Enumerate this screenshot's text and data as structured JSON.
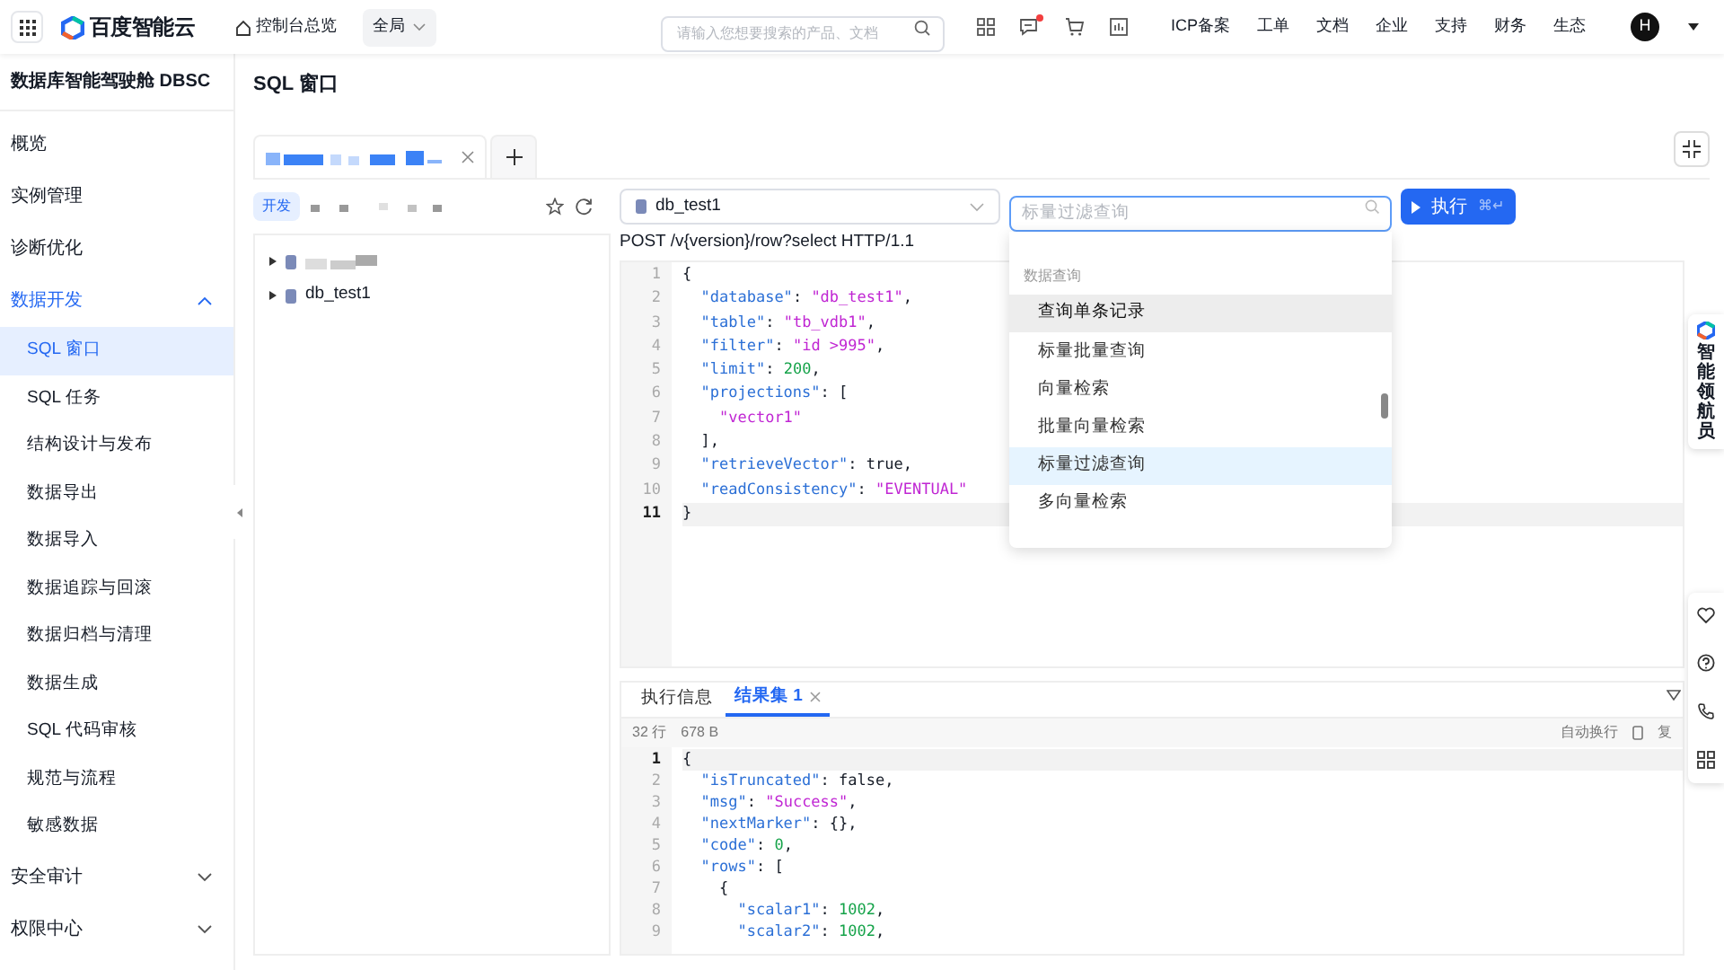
{
  "topbar": {
    "logo": "百度智能云",
    "console": "控制台总览",
    "scope": "全局",
    "search": {
      "placeholder": "请输入您想要搜索的产品、文档"
    },
    "links": [
      "ICP备案",
      "工单",
      "文档",
      "企业",
      "支持",
      "财务",
      "生态"
    ],
    "avatar": "H",
    "has_message_dot": true
  },
  "sidebar": {
    "title": "数据库智能驾驶舱 DBSC",
    "items": [
      {
        "label": "概览",
        "selected": false
      },
      {
        "label": "实例管理",
        "selected": false
      },
      {
        "label": "诊断优化",
        "selected": false
      },
      {
        "label": "数据开发",
        "expanded": true,
        "children": [
          {
            "label": "SQL 窗口",
            "selected": true
          },
          {
            "label": "SQL 任务",
            "selected": false
          },
          {
            "label": "结构设计与发布",
            "selected": false
          },
          {
            "label": "数据导出",
            "selected": false
          },
          {
            "label": "数据导入",
            "selected": false
          },
          {
            "label": "数据追踪与回滚",
            "selected": false
          },
          {
            "label": "数据归档与清理",
            "selected": false
          },
          {
            "label": "数据生成",
            "selected": false
          },
          {
            "label": "SQL 代码审核",
            "selected": false
          },
          {
            "label": "规范与流程",
            "selected": false
          },
          {
            "label": "敏感数据",
            "selected": false
          }
        ]
      },
      {
        "label": "安全审计",
        "expanded": false
      },
      {
        "label": "权限中心",
        "expanded": false
      }
    ]
  },
  "page_title": "SQL 窗口",
  "env_tag": "开发",
  "tree": [
    {
      "redacted": true
    },
    {
      "label": "db_test1",
      "redacted": false
    }
  ],
  "database_select": "db_test1",
  "api_search": {
    "placeholder": "标量过滤查询"
  },
  "run_button": {
    "label": "执行",
    "shortcut": "⌘↵"
  },
  "request_line": "POST /v{version}/row?select HTTP/1.1",
  "editor_lines": [
    {
      "number": "1",
      "code": "{",
      "current": false
    },
    {
      "number": "2",
      "code": "  \"database\": \"db_test1\",",
      "current": false
    },
    {
      "number": "3",
      "code": "  \"table\": \"tb_vdb1\",",
      "current": false
    },
    {
      "number": "4",
      "code": "  \"filter\": \"id >995\",",
      "current": false
    },
    {
      "number": "5",
      "code": "  \"limit\": 200,",
      "current": false
    },
    {
      "number": "6",
      "code": "  \"projections\": [",
      "current": false
    },
    {
      "number": "7",
      "code": "    \"vector1\"",
      "current": false
    },
    {
      "number": "8",
      "code": "  ],",
      "current": false
    },
    {
      "number": "9",
      "code": "  \"retrieveVector\": true,",
      "current": false
    },
    {
      "number": "10",
      "code": "  \"readConsistency\": \"EVENTUAL\"",
      "current": false
    },
    {
      "number": "11",
      "code": "}",
      "current": true
    }
  ],
  "dropdown": {
    "group": "数据查询",
    "options": [
      {
        "label": "查询单条记录",
        "hovered": true,
        "selected": false
      },
      {
        "label": "标量批量查询",
        "hovered": false,
        "selected": false
      },
      {
        "label": "向量检索",
        "hovered": false,
        "selected": false
      },
      {
        "label": "批量向量检索",
        "hovered": false,
        "selected": false
      },
      {
        "label": "标量过滤查询",
        "hovered": false,
        "selected": true
      },
      {
        "label": "多向量检索",
        "hovered": false,
        "selected": false
      }
    ]
  },
  "result_tabs": [
    {
      "label": "执行信息",
      "selected": false,
      "closable": false
    },
    {
      "label": "结果集 1",
      "selected": true,
      "closable": true
    }
  ],
  "result_stats": [
    "32 行",
    "678 B"
  ],
  "result_actions": {
    "wrap": "自动换行",
    "copy": "复"
  },
  "result_lines": [
    {
      "number": "1",
      "code": "{",
      "current": true
    },
    {
      "number": "2",
      "code": "  \"isTruncated\": false,",
      "current": false
    },
    {
      "number": "3",
      "code": "  \"msg\": \"Success\",",
      "current": false
    },
    {
      "number": "4",
      "code": "  \"nextMarker\": {},",
      "current": false
    },
    {
      "number": "5",
      "code": "  \"code\": 0,",
      "current": false
    },
    {
      "number": "6",
      "code": "  \"rows\": [",
      "current": false
    },
    {
      "number": "7",
      "code": "    {",
      "current": false
    },
    {
      "number": "8",
      "code": "      \"scalar1\": 1002,",
      "current": false
    },
    {
      "number": "9",
      "code": "      \"scalar2\": 1002,",
      "current": false
    }
  ],
  "assistant": "智能领航员"
}
